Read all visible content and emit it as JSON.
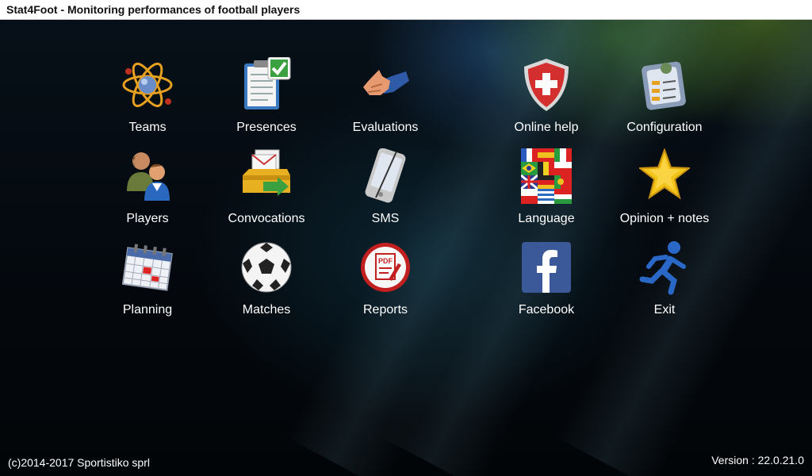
{
  "window": {
    "title": "Stat4Foot - Monitoring performances of football players"
  },
  "menu": {
    "items": [
      {
        "id": "teams",
        "label": "Teams",
        "icon": "atom-icon"
      },
      {
        "id": "presences",
        "label": "Presences",
        "icon": "clipboard-check-icon"
      },
      {
        "id": "evaluations",
        "label": "Evaluations",
        "icon": "thumbs-up-icon"
      },
      {
        "id": "online_help",
        "label": "Online help",
        "icon": "shield-cross-icon"
      },
      {
        "id": "configuration",
        "label": "Configuration",
        "icon": "settings-panel-icon"
      },
      {
        "id": "players",
        "label": "Players",
        "icon": "users-icon"
      },
      {
        "id": "convocations",
        "label": "Convocations",
        "icon": "letters-arrow-icon"
      },
      {
        "id": "sms",
        "label": "SMS",
        "icon": "smartphone-icon"
      },
      {
        "id": "language",
        "label": "Language",
        "icon": "flags-icon"
      },
      {
        "id": "opinion_notes",
        "label": "Opinion + notes",
        "icon": "star-icon"
      },
      {
        "id": "planning",
        "label": "Planning",
        "icon": "calendar-icon"
      },
      {
        "id": "matches",
        "label": "Matches",
        "icon": "soccer-ball-icon"
      },
      {
        "id": "reports",
        "label": "Reports",
        "icon": "pdf-icon"
      },
      {
        "id": "facebook",
        "label": "Facebook",
        "icon": "facebook-icon"
      },
      {
        "id": "exit",
        "label": "Exit",
        "icon": "running-man-icon"
      }
    ]
  },
  "footer": {
    "copyright": "(c)2014-2017 Sportistiko sprl",
    "version": "Version : 22.0.21.0"
  },
  "colors": {
    "title_bg": "#ffffff",
    "background": "#050a10",
    "label": "#ffffff"
  }
}
